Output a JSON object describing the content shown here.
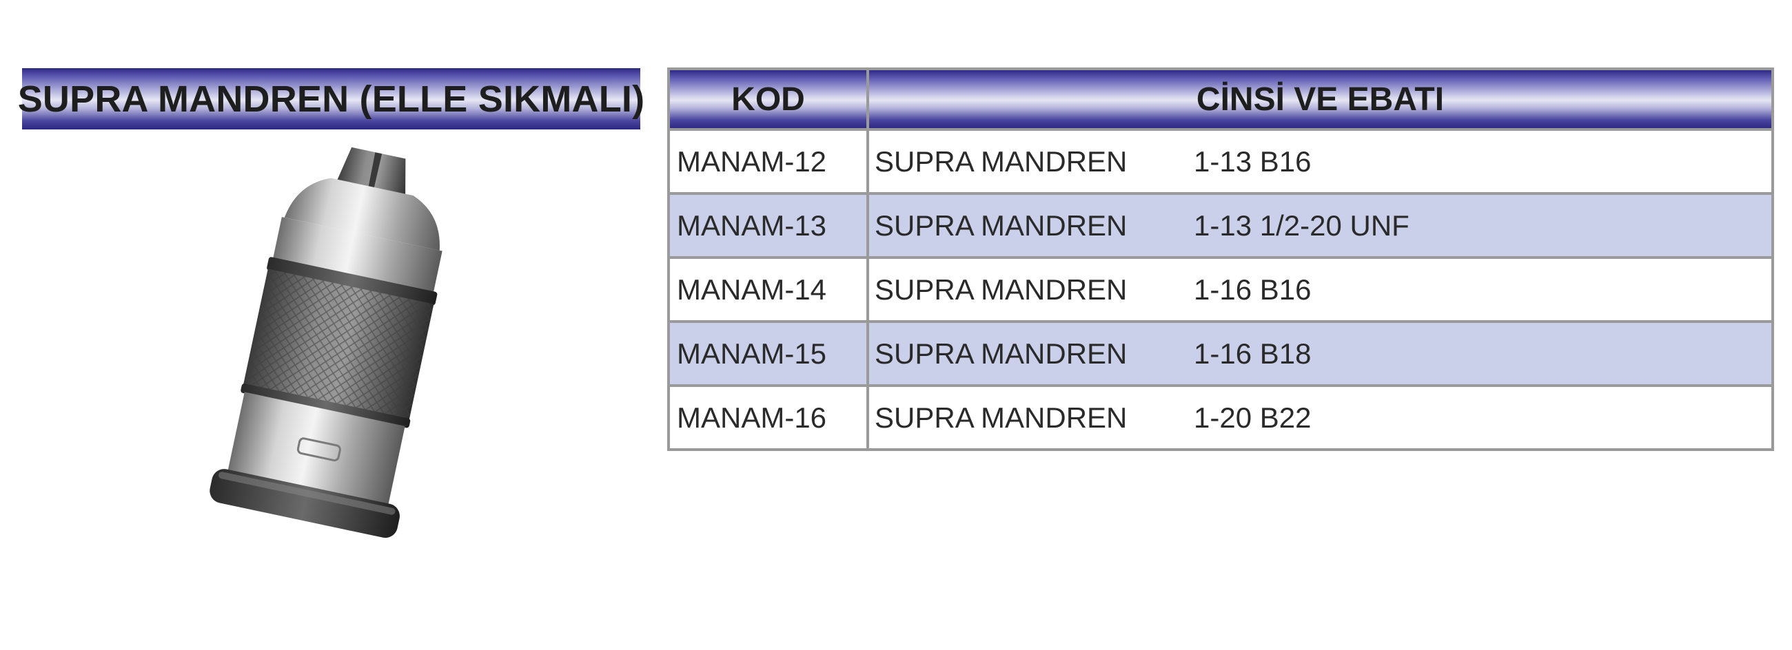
{
  "title": "SUPRA MANDREN (ELLE SIKMALI)",
  "image": {
    "icon": "keyless-drill-chuck-photo"
  },
  "colors": {
    "header_gradient_dark": "#2e2a85",
    "header_gradient_light": "#e6e6f4",
    "alt_row": "#cbd0ea",
    "border": "#9a9a9a"
  },
  "table": {
    "headers": {
      "code": "KOD",
      "description": "CİNSİ VE EBATI"
    },
    "rows": [
      {
        "code": "MANAM-12",
        "name": "SUPRA MANDREN",
        "size": "1-13 B16"
      },
      {
        "code": "MANAM-13",
        "name": "SUPRA MANDREN",
        "size": "1-13 1/2-20 UNF"
      },
      {
        "code": "MANAM-14",
        "name": "SUPRA MANDREN",
        "size": "1-16 B16"
      },
      {
        "code": "MANAM-15",
        "name": "SUPRA MANDREN",
        "size": "1-16 B18"
      },
      {
        "code": "MANAM-16",
        "name": "SUPRA MANDREN",
        "size": "1-20 B22"
      }
    ]
  }
}
